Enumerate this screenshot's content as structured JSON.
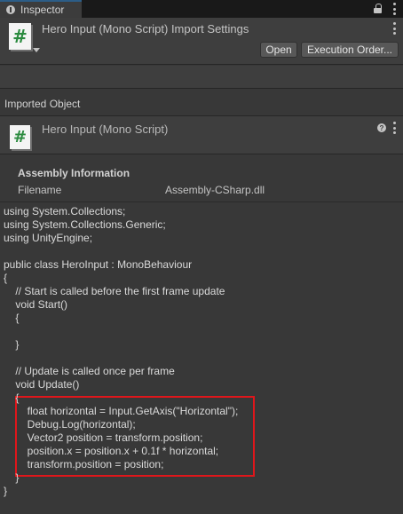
{
  "tab": {
    "label": "Inspector"
  },
  "header": {
    "title": "Hero Input (Mono Script) Import Settings",
    "open_label": "Open",
    "exec_label": "Execution Order..."
  },
  "imported": {
    "section_label": "Imported Object",
    "object_title": "Hero Input (Mono Script)",
    "icon_glyph": "#"
  },
  "assembly": {
    "title": "Assembly Information",
    "key": "Filename",
    "value": "Assembly-CSharp.dll"
  },
  "code": {
    "lines": [
      "using System.Collections;",
      "using System.Collections.Generic;",
      "using UnityEngine;",
      "",
      "public class HeroInput : MonoBehaviour",
      "{",
      "    // Start is called before the first frame update",
      "    void Start()",
      "    {",
      "",
      "    }",
      "",
      "    // Update is called once per frame",
      "    void Update()",
      "    {",
      "        float horizontal = Input.GetAxis(\"Horizontal\");",
      "        Debug.Log(horizontal);",
      "        Vector2 position = transform.position;",
      "        position.x = position.x + 0.1f * horizontal;",
      "        transform.position = position;",
      "    }",
      "}"
    ]
  },
  "colors": {
    "highlight": "#e0161b",
    "tab_accent": "#2c5d87",
    "icon_green": "#2a8a3e"
  }
}
